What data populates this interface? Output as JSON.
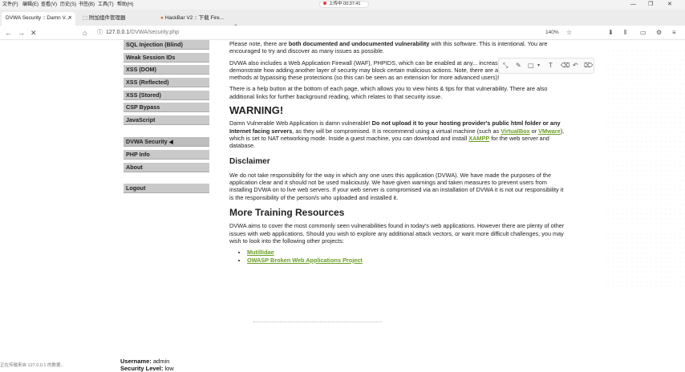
{
  "os_menu": {
    "items": [
      "文件(F)",
      "编辑(E)",
      "查看(V)",
      "历史(S)",
      "书签(B)",
      "工具(T)",
      "帮助(H)"
    ],
    "recording": "上传中 00:37:41"
  },
  "tabs": [
    {
      "label": "DVWA Security :: Damn V...",
      "active": true
    },
    {
      "label": "附加组件管理器",
      "active": false
    },
    {
      "label": "HackBar V2 :: 下载 Fire...",
      "active": false
    }
  ],
  "toolbar": {
    "url_host": "127.0.0.1",
    "url_path": "/DVWA/security.php",
    "zoom": "140%"
  },
  "sidebar": {
    "items": [
      {
        "label": "SQL Injection (Blind)"
      },
      {
        "label": "Weak Session IDs"
      },
      {
        "label": "XSS (DOM)"
      },
      {
        "label": "XSS (Reflected)"
      },
      {
        "label": "XSS (Stored)"
      },
      {
        "label": "CSP Bypass"
      },
      {
        "label": "JavaScript"
      },
      {
        "label": "DVWA Security"
      },
      {
        "label": "PHP Info"
      },
      {
        "label": "About"
      },
      {
        "label": "Logout"
      }
    ]
  },
  "content": {
    "p1_a": "Please note, there are ",
    "p1_b": "both documented and undocumented vulnerability",
    "p1_c": " with this software. This is intentional. You are encouraged to try and discover as many issues as possible.",
    "p2": "DVWA also includes a Web Application Firewall (WAF), PHPIDS, which can be enabled at any... increase the difficulty. This will demonstrate how adding another layer of security may block certain malicious actions. Note, there are also various public methods at bypassing these protections (so this can be seen as an extension for more advanced users)!",
    "p3": "There is a help button at the bottom of each page, which allows you to view hints & tips for that vulnerability. There are also additional links for further background reading, which relates to that security issue.",
    "warning_title": "WARNING!",
    "w_a": "Damn Vulnerable Web Application is damn vulnerable! ",
    "w_b": "Do not upload it to your hosting provider's public html folder or any Internet facing servers",
    "w_c": ", as they will be compromised. It is recommend using a virtual machine (such as ",
    "w_link1": "VirtualBox",
    "w_d": " or ",
    "w_link2": "VMware",
    "w_e": "), which is set to NAT networking mode. Inside a guest machine, you can download and install ",
    "w_link3": "XAMPP",
    "w_f": " for the web server and database.",
    "disclaimer_title": "Disclaimer",
    "disclaimer": "We do not take responsibility for the way in which any one uses this application (DVWA). We have made the purposes of the application clear and it should not be used maliciously. We have given warnings and taken measures to prevent users from installing DVWA on to live web servers. If your web server is compromised via an installation of DVWA it is not our responsibility it is the responsibility of the person/s who uploaded and installed it.",
    "training_title": "More Training Resources",
    "training": "DVWA aims to cover the most commonly seen vulnerabilities found in today's web applications. However there are plenty of other issues with web applications. Should you wish to explore any additional attack vectors, or want more difficult challenges, you may wish to look into the following other projects:",
    "links": [
      "Mutillidae",
      "OWASP Broken Web Applications Project"
    ]
  },
  "footer": {
    "username_label": "Username:",
    "username": "admin",
    "level_label": "Security Level:",
    "level": "low",
    "status": "正在传输来自 127.0.0.1 的数据..."
  }
}
